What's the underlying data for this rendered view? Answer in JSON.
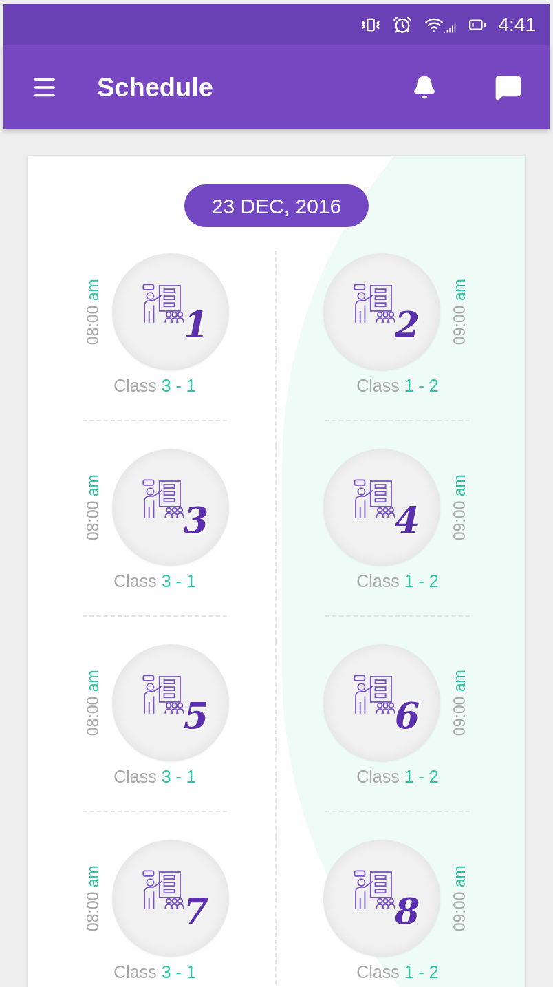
{
  "status_bar": {
    "time": "4:41"
  },
  "app_bar": {
    "title": "Schedule"
  },
  "date": "23 DEC, 2016",
  "sessions": [
    {
      "period": "1",
      "time": "08:00",
      "meridiem": "am",
      "label": "Class",
      "code": "3 - 1"
    },
    {
      "period": "2",
      "time": "09:00",
      "meridiem": "am",
      "label": "Class",
      "code": "1 - 2"
    },
    {
      "period": "3",
      "time": "08:00",
      "meridiem": "am",
      "label": "Class",
      "code": "3 - 1"
    },
    {
      "period": "4",
      "time": "09:00",
      "meridiem": "am",
      "label": "Class",
      "code": "1 - 2"
    },
    {
      "period": "5",
      "time": "08:00",
      "meridiem": "am",
      "label": "Class",
      "code": "3 - 1"
    },
    {
      "period": "6",
      "time": "09:00",
      "meridiem": "am",
      "label": "Class",
      "code": "1 - 2"
    },
    {
      "period": "7",
      "time": "08:00",
      "meridiem": "am",
      "label": "Class",
      "code": "3 - 1"
    },
    {
      "period": "8",
      "time": "09:00",
      "meridiem": "am",
      "label": "Class",
      "code": "1 - 2"
    }
  ]
}
